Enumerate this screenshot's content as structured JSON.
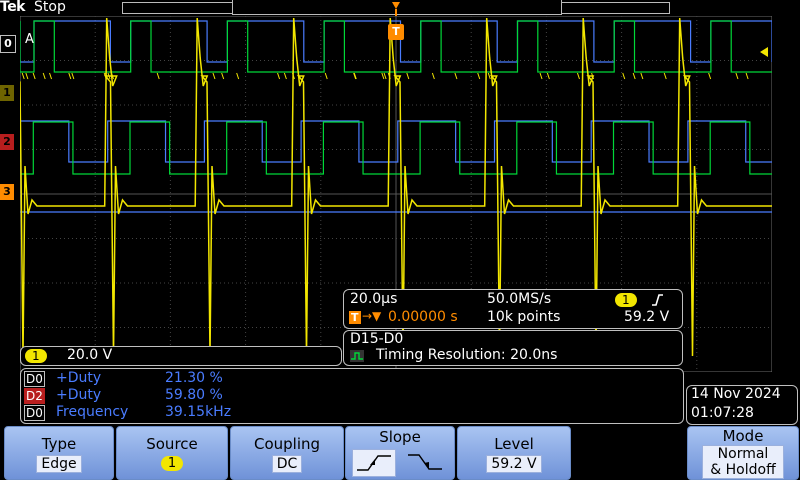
{
  "header": {
    "brand": "Tek",
    "run_state": "Stop"
  },
  "channel_markers": [
    {
      "label": "0",
      "color": "#bfbfbf"
    },
    {
      "label": "1",
      "color": "#6e6400"
    },
    {
      "label": "2",
      "color": "#b81e1e"
    },
    {
      "label": "3",
      "color": "#ff8c00"
    }
  ],
  "grid_label": "A",
  "trigger_marker": "T",
  "ch1_scale": {
    "badge": "1",
    "value": "20.0 V"
  },
  "timebase": {
    "time_per_div": "20.0µs",
    "sample_rate": "50.0MS/s",
    "trigger_source_badge": "1",
    "trigger_level": "59.2 V",
    "trigger_pos_badge": "T",
    "trigger_offset": "0.00000 s",
    "record_length": "10k points"
  },
  "digital": {
    "group": "D15-D0",
    "timing_resolution": "Timing Resolution: 20.0ns"
  },
  "measurements": [
    {
      "source": "D0",
      "source_color": "#bfbfbf",
      "name": "+Duty",
      "value": "21.30 %"
    },
    {
      "source": "D2",
      "source_color": "#b81e1e",
      "name": "+Duty",
      "value": "59.80 %"
    },
    {
      "source": "D0",
      "source_color": "#bfbfbf",
      "name": "Frequency",
      "value": "39.15kHz"
    }
  ],
  "clock": {
    "date": "14 Nov 2024",
    "time": "01:07:28"
  },
  "softkeys": {
    "type": {
      "title": "Type",
      "value": "Edge"
    },
    "source": {
      "title": "Source",
      "value": "1"
    },
    "coupling": {
      "title": "Coupling",
      "value": "DC"
    },
    "slope": {
      "title": "Slope"
    },
    "level": {
      "title": "Level",
      "value": "59.2 V"
    },
    "mode": {
      "title": "Mode",
      "value1": "Normal",
      "value2": "& Holdoff"
    }
  },
  "colors": {
    "analog": "#f2e600",
    "digital_green": "#00d838",
    "digital_blue": "#4a7cff",
    "trigger": "#ff8c00"
  }
}
